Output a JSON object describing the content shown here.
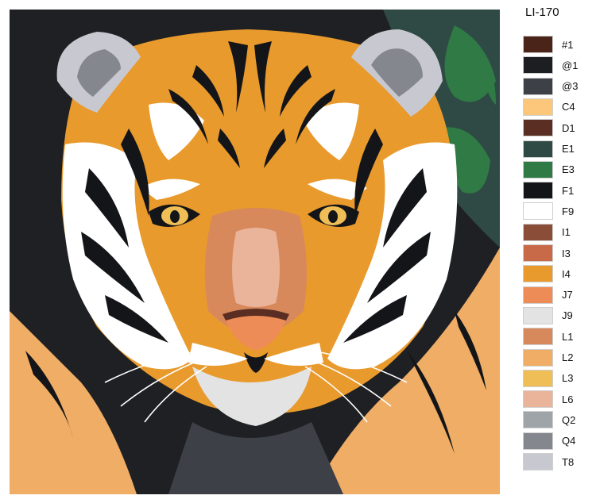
{
  "kit_code": "LI-170",
  "palette": [
    {
      "code": "#1",
      "color": "#4a2418"
    },
    {
      "code": "@1",
      "color": "#1d1e22"
    },
    {
      "code": "@3",
      "color": "#3d4047"
    },
    {
      "code": "C4",
      "color": "#fcc77a"
    },
    {
      "code": "D1",
      "color": "#5a2e22"
    },
    {
      "code": "E1",
      "color": "#2f4a45"
    },
    {
      "code": "E3",
      "color": "#2f7a45"
    },
    {
      "code": "F1",
      "color": "#141518"
    },
    {
      "code": "F9",
      "color": "#ffffff"
    },
    {
      "code": "I1",
      "color": "#8a4e38"
    },
    {
      "code": "I3",
      "color": "#c86a48"
    },
    {
      "code": "I4",
      "color": "#e99a2c"
    },
    {
      "code": "J7",
      "color": "#ee8c58"
    },
    {
      "code": "J9",
      "color": "#e3e3e3"
    },
    {
      "code": "L1",
      "color": "#d8895b"
    },
    {
      "code": "L2",
      "color": "#f0ad65"
    },
    {
      "code": "L3",
      "color": "#f0be57"
    },
    {
      "code": "L6",
      "color": "#eab49a"
    },
    {
      "code": "Q2",
      "color": "#9ea4a8"
    },
    {
      "code": "Q4",
      "color": "#84878d"
    },
    {
      "code": "T8",
      "color": "#c8c9d0"
    }
  ]
}
